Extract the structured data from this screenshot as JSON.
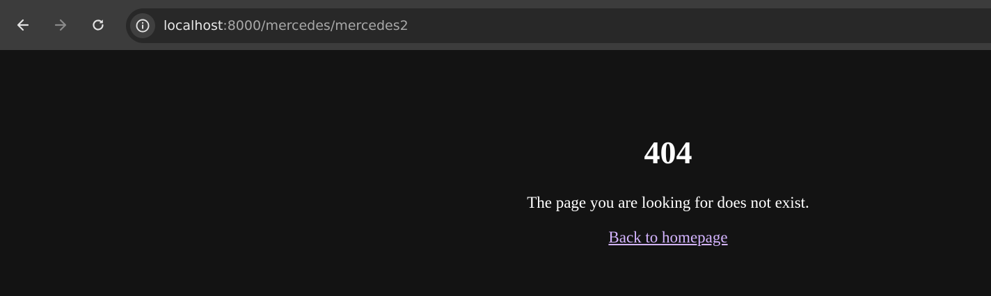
{
  "browser": {
    "url_host": "localhost",
    "url_rest": ":8000/mercedes/mercedes2",
    "icons": {
      "back": "arrow-left-icon",
      "forward": "arrow-right-icon",
      "reload": "reload-icon",
      "site_info": "info-icon"
    }
  },
  "page": {
    "heading": "404",
    "message": "The page you are looking for does not exist.",
    "link_label": "Back to homepage",
    "link_color": "#d4b4ff",
    "background": "#131313"
  }
}
